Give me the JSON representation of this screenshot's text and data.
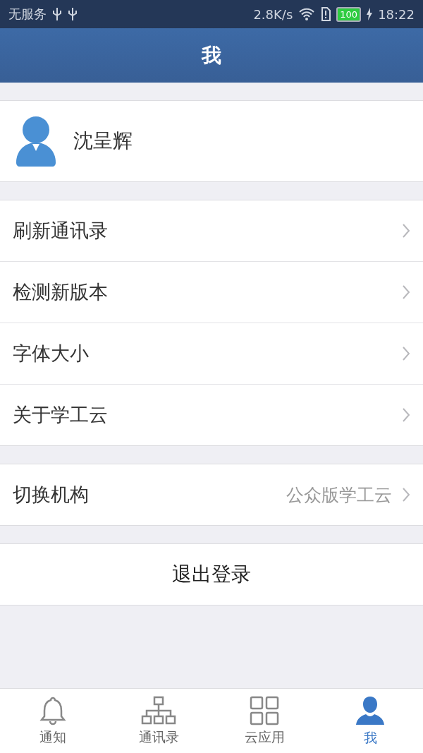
{
  "status_bar": {
    "carrier": "无服务",
    "speed": "2.8K/s",
    "battery": "100",
    "time": "18:22"
  },
  "header": {
    "title": "我"
  },
  "profile": {
    "name": "沈呈辉"
  },
  "menu_groups": [
    [
      {
        "label": "刷新通讯录"
      },
      {
        "label": "检测新版本"
      },
      {
        "label": "字体大小"
      },
      {
        "label": "关于学工云"
      }
    ],
    [
      {
        "label": "切换机构",
        "value": "公众版学工云"
      }
    ]
  ],
  "logout": {
    "label": "退出登录"
  },
  "tabs": [
    {
      "kind": "bell",
      "label": "通知",
      "selected": false
    },
    {
      "kind": "tree",
      "label": "通讯录",
      "selected": false
    },
    {
      "kind": "grid",
      "label": "云应用",
      "selected": false
    },
    {
      "kind": "person",
      "label": "我",
      "selected": true
    }
  ]
}
